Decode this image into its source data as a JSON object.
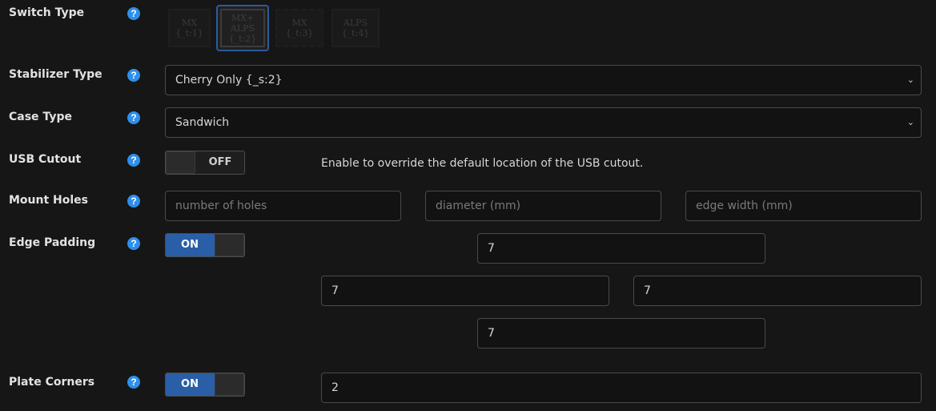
{
  "switch_type": {
    "label": "Switch Type",
    "options": [
      {
        "line1": "MX",
        "line2": "",
        "code": "{_t:1}"
      },
      {
        "line1": "MX+",
        "line2": "ALPS",
        "code": "{_t:2}"
      },
      {
        "line1": "MX",
        "line2": "",
        "code": "{_t:3}"
      },
      {
        "line1": "ALPS",
        "line2": "",
        "code": "{_t:4}"
      }
    ],
    "selected": "{_t:2}"
  },
  "stabilizer_type": {
    "label": "Stabilizer Type",
    "value": "Cherry Only {_s:2}"
  },
  "case_type": {
    "label": "Case Type",
    "value": "Sandwich"
  },
  "usb_cutout": {
    "label": "USB Cutout",
    "toggle": "OFF",
    "note": "Enable to override the default location of the USB cutout."
  },
  "mount_holes": {
    "label": "Mount Holes",
    "num_placeholder": "number of holes",
    "diam_placeholder": "diameter (mm)",
    "edge_placeholder": "edge width (mm)"
  },
  "edge_padding": {
    "label": "Edge Padding",
    "toggle": "ON",
    "top": "7",
    "left": "7",
    "right": "7",
    "bottom": "7"
  },
  "plate_corners": {
    "label": "Plate Corners",
    "toggle": "ON",
    "value": "2"
  },
  "help_glyph": "?",
  "chevron_glyph": "⌄",
  "colors": {
    "accent": "#2a5ea6",
    "help": "#2f8fea",
    "background": "#161616"
  }
}
